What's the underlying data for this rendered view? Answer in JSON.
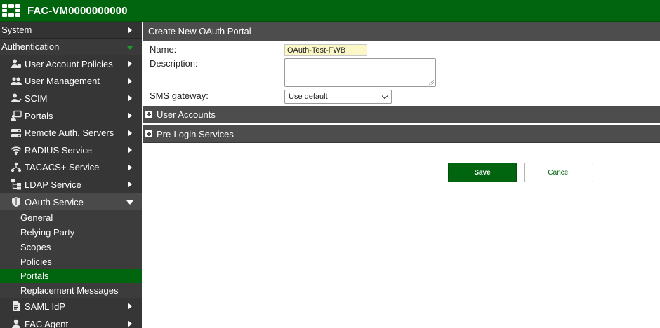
{
  "app": {
    "title": "FAC-VM0000000000"
  },
  "sidebar": {
    "sections": [
      {
        "label": "System",
        "icon": "chevron-right-icon"
      },
      {
        "label": "Authentication",
        "icon": "chevron-down-icon"
      }
    ],
    "items": [
      {
        "label": "User Account Policies",
        "icon": "user-policy-icon"
      },
      {
        "label": "User Management",
        "icon": "users-icon"
      },
      {
        "label": "SCIM",
        "icon": "scim-icon"
      },
      {
        "label": "Portals",
        "icon": "portal-icon"
      },
      {
        "label": "Remote Auth. Servers",
        "icon": "server-icon"
      },
      {
        "label": "RADIUS Service",
        "icon": "wireless-icon"
      },
      {
        "label": "TACACS+ Service",
        "icon": "network-icon"
      },
      {
        "label": "LDAP Service",
        "icon": "directory-tree-icon"
      },
      {
        "label": "OAuth Service",
        "icon": "shield-icon",
        "expanded": true
      },
      {
        "label": "SAML IdP",
        "icon": "document-icon"
      },
      {
        "label": "FAC Agent",
        "icon": "agent-icon"
      }
    ],
    "oauth_children": [
      {
        "label": "General"
      },
      {
        "label": "Relying Party"
      },
      {
        "label": "Scopes"
      },
      {
        "label": "Policies"
      },
      {
        "label": "Portals",
        "selected": true
      },
      {
        "label": "Replacement Messages"
      }
    ]
  },
  "main": {
    "header": "Create New OAuth Portal",
    "form": {
      "name_label": "Name:",
      "name_value": "OAuth-Test-FWB",
      "description_label": "Description:",
      "description_value": "",
      "sms_label": "SMS gateway:",
      "sms_value": "Use default"
    },
    "sections": [
      {
        "label": "User Accounts"
      },
      {
        "label": "Pre-Login Services"
      }
    ],
    "buttons": {
      "save": "Save",
      "cancel": "Cancel"
    }
  },
  "colors": {
    "brand_green": "#00650e",
    "sidebar_bg": "#363636",
    "section_bar": "#4d4d4d",
    "input_highlight": "#fbf7c7"
  }
}
